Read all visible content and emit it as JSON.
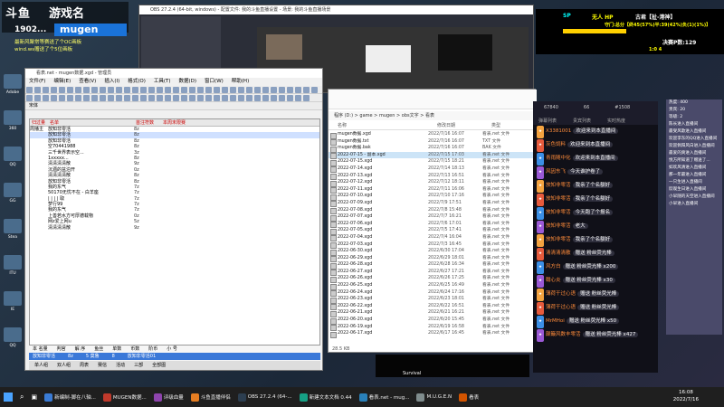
{
  "stream": {
    "brand": "斗鱼",
    "name_big": "游戏名",
    "room_no": "1902...",
    "user_badge": "mugen",
    "notice1": "最新风聚常等赛送了个OC画板",
    "notice2": "wind.ws赠送了个5位画板"
  },
  "desktop_icons": [
    "Adobe",
    "360",
    "QQ",
    "GG",
    "Stea",
    "ITU",
    "IE",
    "QQ"
  ],
  "obs": {
    "title": "OBS 27.2.4 (64-bit, windows) - 配置文件: 我的斗鱼直播设置 - 场景: 我的斗鱼直播场景"
  },
  "editor": {
    "title": "看表.net - mugen数据.xgd - 管理员",
    "menu": [
      "文件(F)",
      "编辑(E)",
      "查看(V)",
      "插入(I)",
      "格式(O)",
      "工具(T)",
      "数据(D)",
      "窗口(W)",
      "帮助(H)"
    ],
    "font_name": "宋体",
    "header": [
      "归过量",
      "名单",
      "首注符数",
      "本周末限赛"
    ],
    "rows": [
      [
        "周播主",
        "放知非零活",
        "8z"
      ],
      [
        "",
        "放知非零活",
        "8z"
      ],
      [
        "",
        "放知非零活",
        "8z"
      ],
      [
        "",
        "空70441988",
        "8z"
      ],
      [
        "",
        "三千世界表示空...",
        "3z"
      ],
      [
        "",
        "1xxxxx...",
        "8z"
      ],
      [
        "",
        "清清清清散",
        "9z"
      ],
      [
        "",
        "沉湎的盆泊开",
        "0z"
      ],
      [
        "",
        "清清清清散",
        "8z"
      ],
      [
        "",
        "放知非零活",
        "8z"
      ],
      [
        "",
        "我的东气",
        "7z"
      ],
      [
        "",
        "50170无忧不在 - 白羊座",
        "7z"
      ],
      [
        "",
        "| | | | 取",
        "7z"
      ],
      [
        "",
        "梦行99",
        "7z"
      ],
      [
        "",
        "我的东气",
        "7z"
      ],
      [
        "",
        "上善若水方可厚德载物",
        "0z"
      ],
      [
        "",
        "网z爱上网u",
        "5z"
      ],
      [
        "",
        "清清清清散",
        "9z"
      ]
    ],
    "status_cols": [
      "本 名量",
      "判官",
      "解 序",
      "鱼丝",
      "单数",
      "币数",
      "阶币",
      "小 号"
    ],
    "status_values": [
      "放知非零活",
      "8z",
      "5 莫鲁",
      "8",
      "放知非零活01"
    ],
    "tabs": [
      "单人组",
      "双人组",
      "周表",
      "赛信",
      "活动",
      "三部",
      "全部图"
    ]
  },
  "explorer": {
    "path": "程序 (D:) > game > mugen > obs文字 > 看表",
    "columns": [
      "名称",
      "修改日期",
      "类型"
    ],
    "files": [
      [
        "mugen数据.xgd",
        "2022/7/16 16:07",
        "看表.net 文件"
      ],
      [
        "mugen数据.txt",
        "2022/7/16 16:07",
        "TXT 文件"
      ],
      [
        "mugen数据.bak",
        "2022/7/16 16:07",
        "BAK 文件"
      ],
      [
        "2022-07-15 - 副本.xgd",
        "2022/7/15 17:03",
        "看表.net 文件"
      ],
      [
        "2022-07-15.xgd",
        "2022/7/15 18:21",
        "看表.net 文件"
      ],
      [
        "2022-07-14.xgd",
        "2022/7/14 18:13",
        "看表.net 文件"
      ],
      [
        "2022-07-13.xgd",
        "2022/7/13 16:51",
        "看表.net 文件"
      ],
      [
        "2022-07-12.xgd",
        "2022/7/12 18:11",
        "看表.net 文件"
      ],
      [
        "2022-07-11.xgd",
        "2022/7/11 16:06",
        "看表.net 文件"
      ],
      [
        "2022-07-10.xgd",
        "2022/7/10 17:16",
        "看表.net 文件"
      ],
      [
        "2022-07-09.xgd",
        "2022/7/9 17:51",
        "看表.net 文件"
      ],
      [
        "2022-07-08.xgd",
        "2022/7/8 15:48",
        "看表.net 文件"
      ],
      [
        "2022-07-07.xgd",
        "2022/7/7 16:21",
        "看表.net 文件"
      ],
      [
        "2022-07-06.xgd",
        "2022/7/6 17:01",
        "看表.net 文件"
      ],
      [
        "2022-07-05.xgd",
        "2022/7/5 17:41",
        "看表.net 文件"
      ],
      [
        "2022-07-04.xgd",
        "2022/7/4 16:04",
        "看表.net 文件"
      ],
      [
        "2022-07-03.xgd",
        "2022/7/3 16:45",
        "看表.net 文件"
      ],
      [
        "2022-06-30.xgd",
        "2022/6/30 17:04",
        "看表.net 文件"
      ],
      [
        "2022-06-29.xgd",
        "2022/6/29 18:01",
        "看表.net 文件"
      ],
      [
        "2022-06-28.xgd",
        "2022/6/28 16:34",
        "看表.net 文件"
      ],
      [
        "2022-06-27.xgd",
        "2022/6/27 17:21",
        "看表.net 文件"
      ],
      [
        "2022-06-26.xgd",
        "2022/6/26 17:25",
        "看表.net 文件"
      ],
      [
        "2022-06-25.xgd",
        "2022/6/25 16:49",
        "看表.net 文件"
      ],
      [
        "2022-06-24.xgd",
        "2022/6/24 17:16",
        "看表.net 文件"
      ],
      [
        "2022-06-23.xgd",
        "2022/6/23 18:01",
        "看表.net 文件"
      ],
      [
        "2022-06-22.xgd",
        "2022/6/22 16:51",
        "看表.net 文件"
      ],
      [
        "2022-06-21.xgd",
        "2022/6/21 16:21",
        "看表.net 文件"
      ],
      [
        "2022-06-20.xgd",
        "2022/6/20 15:45",
        "看表.net 文件"
      ],
      [
        "2022-06-19.xgd",
        "2022/6/19 16:58",
        "看表.net 文件"
      ],
      [
        "2022-06-17.xgd",
        "2022/6/17 16:45",
        "看表.net 文件"
      ]
    ],
    "status": "28.5 KB"
  },
  "chat": {
    "stats": [
      "67840",
      "66",
      "#1508"
    ],
    "tabs": [
      "弹幕列表",
      "贵宾列表",
      "实时热度"
    ],
    "messages": [
      {
        "nick": "X3381001",
        "text": "欢迎来到本直播间"
      },
      {
        "nick": "灰色饲料",
        "text": "欢迎来到本直播间"
      },
      {
        "nick": "青雨随中化",
        "text": "欢迎来到本直播间"
      },
      {
        "nick": "风因东飞",
        "text": "今天谁护卷了"
      },
      {
        "nick": "放知非零活",
        "text": "我亲了个名额好"
      },
      {
        "nick": "放知非零活",
        "text": "我亲了个名额好"
      },
      {
        "nick": "放知非零活",
        "text": "今天跑了个报名"
      },
      {
        "nick": "放知非零活",
        "text": "老大"
      },
      {
        "nick": "放知非零活",
        "text": "我亲了个名额好"
      },
      {
        "nick": "清清清清散",
        "text": "赠送 粉丝荧光棒"
      },
      {
        "nick": "风方白",
        "text": "赠送 粉丝荧光棒 x200"
      },
      {
        "nick": "翰心炎",
        "text": "赠送 粉丝荧光棒 x30"
      },
      {
        "nick": "薄荷干过心语",
        "text": "赠送 粉丝荧光棒"
      },
      {
        "nick": "薄荷干过心语",
        "text": "赠送 粉丝荧光棒"
      },
      {
        "nick": "MrMHoi",
        "text": "赠送 粉丝荧光棒 x50"
      },
      {
        "nick": "颠簸风数丰零活",
        "text": "赠送 粉丝荧光棒 x427"
      }
    ]
  },
  "right_panel": {
    "lines": [
      "热度: 400",
      "贵宾: 20",
      "等级: 2",
      "陈长进入直播间",
      "最受风歌进入直播间",
      "欢迎李东的QQ进入直播间",
      "欢迎佩阳风白进入直播间",
      "最爱的爽进入直播间",
      "悦方所知道了赠送了...",
      "如欢风清进入直播间",
      "那一年最进入直播间",
      "一只生进入直播间",
      "欣观生日进入直播间",
      "小早随的天空进入直播间",
      "小早进入直播间"
    ]
  },
  "hud": {
    "score1": "SP",
    "player": "无人 HP",
    "label": "古君【扯-港神】",
    "sub": "守门:总分【终45(57%)平:39(42%)负(1)(1%)】",
    "right_tag": "决赛P数:129",
    "ratio": "1:0 4"
  },
  "game": {
    "label": "Survival"
  },
  "taskbar": {
    "items": [
      "新编制-脚在八轴...",
      "MUGEN数据...",
      "评级血量",
      "斗鱼直播伴侣",
      "OBS 27.2.4 (64-...",
      "新建文本文档 0.44",
      "看表.net - mug...",
      "M.U.G.E.N",
      "看表"
    ],
    "time": "16:08",
    "date": "2022/7/16"
  },
  "colors": {
    "accent": "#1a73d9",
    "hud_yellow": "#ffd000",
    "chat_bg": "#101018"
  }
}
